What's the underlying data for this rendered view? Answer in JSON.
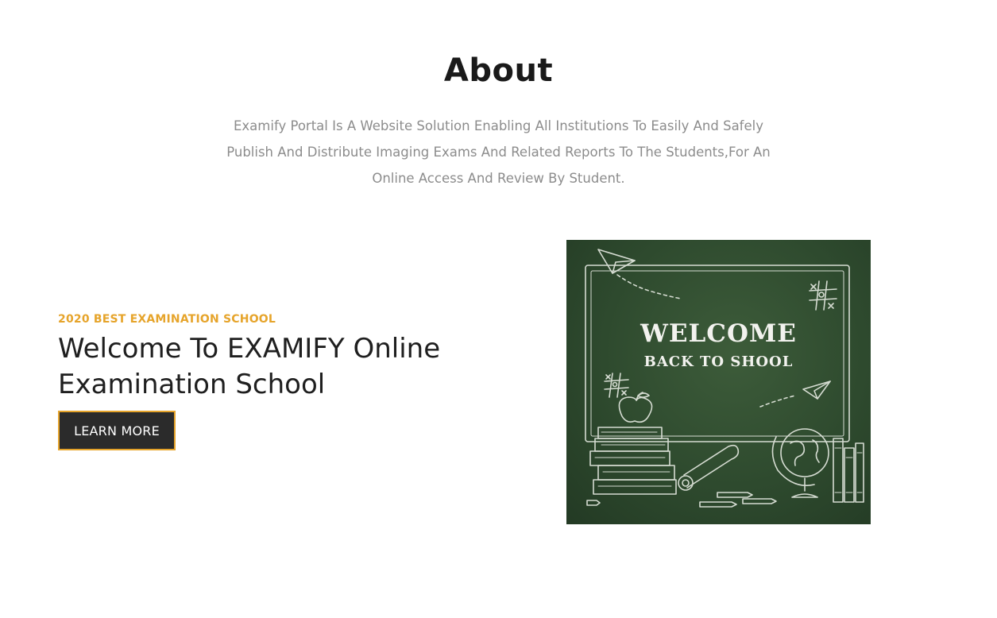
{
  "about": {
    "title": "About",
    "description": "Examify Portal Is A Website Solution Enabling All Institutions To Easily And Safely Publish And Distribute Imaging Exams And Related Reports To The Students,For An Online Access And Review By Student."
  },
  "hero": {
    "eyebrow": "2020 BEST EXAMINATION SCHOOL",
    "headline": "Welcome To EXAMIFY Online Examination School",
    "button_label": "LEARN MORE"
  },
  "illustration": {
    "line1": "WELCOME",
    "line2": "BACK TO SHOOL"
  },
  "colors": {
    "accent": "#e6a42b",
    "button_bg": "#2b2b2b",
    "heading": "#1a1a1a",
    "muted_text": "#8c8c8c",
    "chalkboard": "#2e4a2e"
  }
}
